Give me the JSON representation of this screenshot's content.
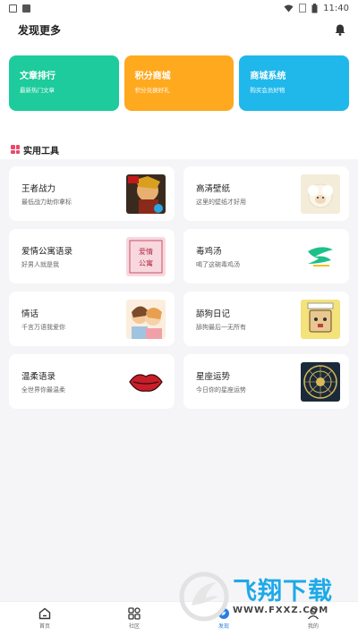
{
  "status_bar": {
    "time": "11:40"
  },
  "header": {
    "title": "发现更多"
  },
  "banners": [
    {
      "title": "文章排行",
      "subtitle": "最新热门文章",
      "color": "#1ecb9c"
    },
    {
      "title": "积分商城",
      "subtitle": "积分兑换好礼",
      "color": "#ffa91f"
    },
    {
      "title": "商城系统",
      "subtitle": "购买会员好物",
      "color": "#20b8ea"
    }
  ],
  "section": {
    "title": "实用工具"
  },
  "tools": [
    {
      "title": "王者战力",
      "subtitle": "最低战力助你拿标",
      "icon": "game-hero-thumb"
    },
    {
      "title": "高清壁纸",
      "subtitle": "这里的壁纸才好用",
      "icon": "sheep-wallpaper-thumb"
    },
    {
      "title": "爱情公寓语录",
      "subtitle": "好男人就是我",
      "icon": "love-apartment-thumb",
      "thumb_text": "爱情公寓"
    },
    {
      "title": "毒鸡汤",
      "subtitle": "喝了这碗毒鸡汤",
      "icon": "soup-logo-thumb"
    },
    {
      "title": "情话",
      "subtitle": "千言万语我爱你",
      "icon": "couple-thumb"
    },
    {
      "title": "舔狗日记",
      "subtitle": "舔狗最后一无所有",
      "icon": "dog-diary-thumb"
    },
    {
      "title": "温柔语录",
      "subtitle": "全世界你最温柔",
      "icon": "lips-thumb"
    },
    {
      "title": "星座运势",
      "subtitle": "今日你的星座运势",
      "icon": "zodiac-thumb"
    }
  ],
  "bottom_nav": [
    {
      "label": "首页",
      "icon": "home-icon"
    },
    {
      "label": "社区",
      "icon": "community-grid-icon"
    },
    {
      "label": "发现",
      "icon": "discover-icon",
      "active": true
    },
    {
      "label": "我的",
      "icon": "profile-icon"
    }
  ],
  "watermark": {
    "cn": "飞翔下载",
    "en": "WWW.FXXZ.COM"
  },
  "colors": {
    "accent": "#2a7de1",
    "section_icon": "#e94a6a"
  }
}
